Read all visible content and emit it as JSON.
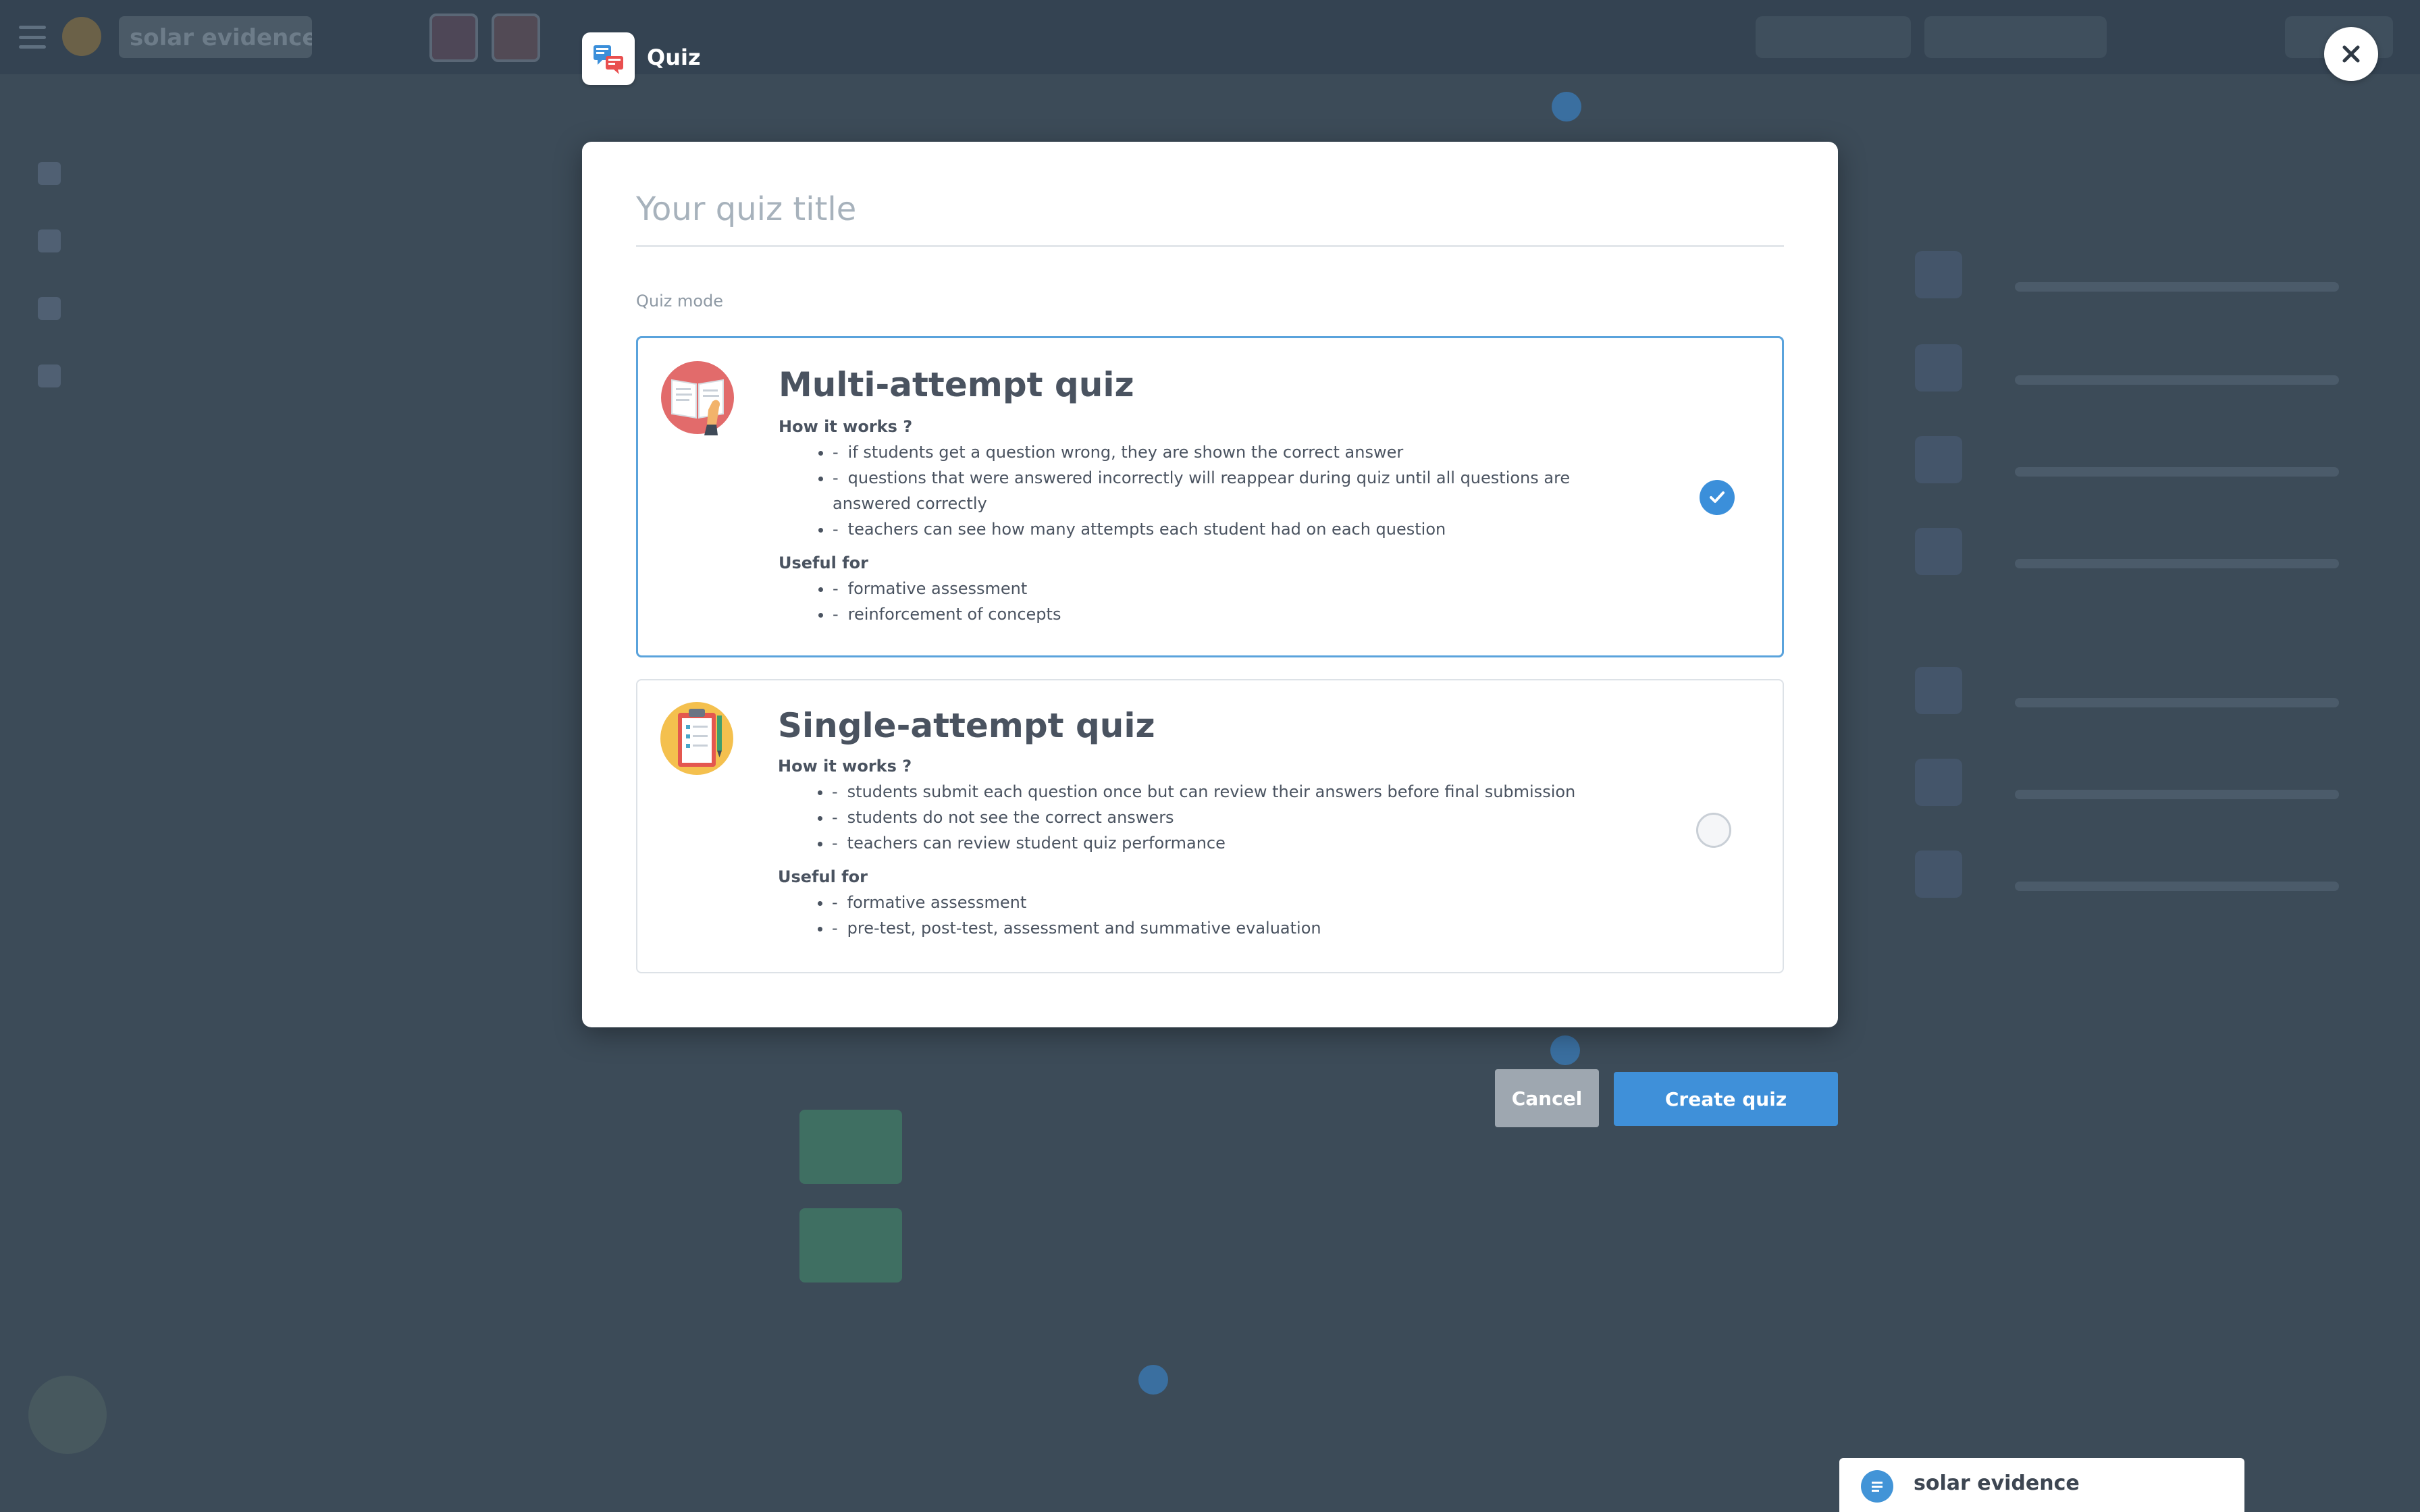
{
  "header": {
    "project_name": "solar evidence",
    "quiz_label": "Quiz"
  },
  "modal": {
    "title_placeholder": "Your quiz title",
    "title_value": "",
    "mode_label": "Quiz mode",
    "options": [
      {
        "title": "Multi-attempt quiz",
        "how_heading": "How it works ?",
        "how_items": [
          "if students get a question wrong, they are shown the correct answer",
          "questions that were answered incorrectly will reappear during quiz until all questions are answered correctly",
          "teachers can see how many attempts each student had on each question"
        ],
        "useful_heading": "Useful for",
        "useful_items": [
          "formative assessment",
          "reinforcement of concepts"
        ],
        "selected": true
      },
      {
        "title": "Single-attempt quiz",
        "how_heading": "How it works ?",
        "how_items": [
          "students submit each question once but can review their answers before final submission",
          "students do not see the correct answers",
          "teachers can review student quiz performance"
        ],
        "useful_heading": "Useful for",
        "useful_items": [
          "formative assessment",
          "pre-test, post-test, assessment and summative evaluation"
        ],
        "selected": false
      }
    ]
  },
  "actions": {
    "cancel": "Cancel",
    "create": "Create quiz"
  },
  "doc_chip": {
    "label": "solar evidence"
  },
  "colors": {
    "accent": "#3f90d9",
    "selected_border": "#5aa3dc",
    "cancel_bg": "#9ea7b0",
    "overlay_bg": "#3c4b58"
  }
}
